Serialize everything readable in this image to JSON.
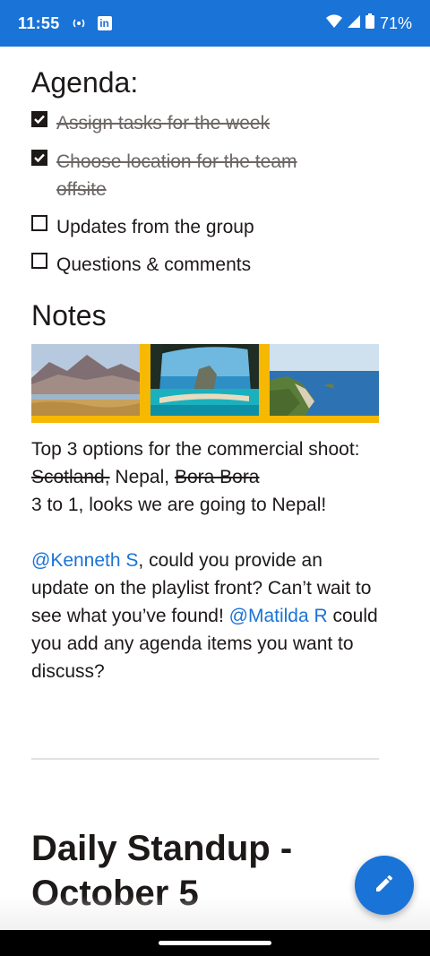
{
  "status_bar": {
    "time": "11:55",
    "battery": "71%",
    "icons": [
      "broadcast-icon",
      "linkedin-icon",
      "wifi-icon",
      "signal-icon",
      "battery-icon"
    ]
  },
  "agenda": {
    "title": "Agenda:",
    "items": [
      {
        "label": "Assign tasks for the week",
        "checked": true
      },
      {
        "label": "Choose location for the team offsite",
        "checked": true
      },
      {
        "label": "Updates from the group",
        "checked": false
      },
      {
        "label": "Questions & comments",
        "checked": false
      }
    ]
  },
  "notes": {
    "title": "Notes",
    "photos": [
      "desert-lake-landscape",
      "sea-arch-cove",
      "coastal-cliffs"
    ],
    "line1_text": "Top 3 options for the commercial shoot: ",
    "option_scotland": "Scotland,",
    "option_nepal": " Nepal, ",
    "option_bora": "Bora Bora",
    "result": "3 to 1, looks we are going to Nepal!",
    "mention1": "@Kenneth S",
    "mention1_text": ", could you provide an update on the playlist front? Can’t wait to see what you’ve found!",
    "mention2": "@Matilda R",
    "mention2_text": " could you add any agenda items you want to discuss?"
  },
  "next_section": {
    "title": "Daily Standup - October 5"
  },
  "fab": {
    "icon": "pencil-icon"
  },
  "colors": {
    "accent": "#1a73d6",
    "photo_frame": "#f6b800",
    "text": "#1e1919"
  }
}
